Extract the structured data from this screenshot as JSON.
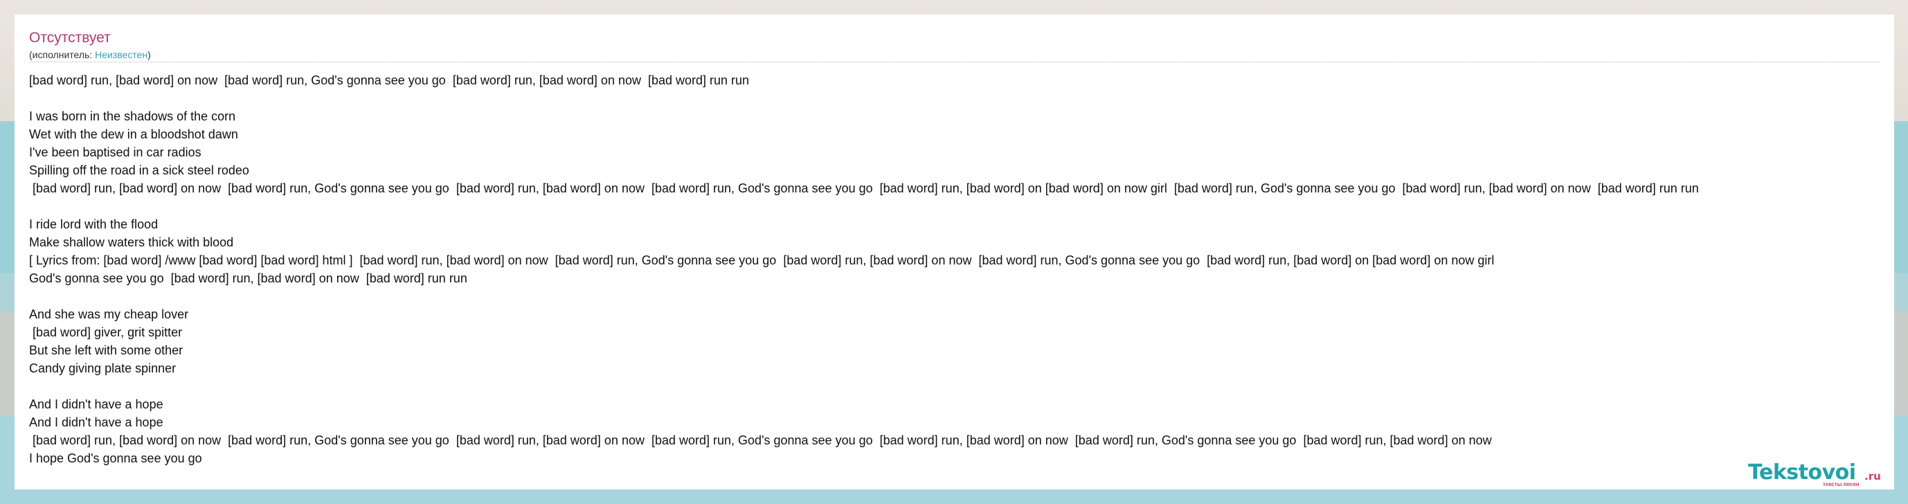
{
  "song": {
    "title": "Отсутствует",
    "artist_prefix": "(исполнитель: ",
    "artist_name": "Неизвестен",
    "artist_suffix": ")"
  },
  "lyrics": [
    "[bad word] run, [bad word] on now  [bad word] run, God's gonna see you go  [bad word] run, [bad word] on now  [bad word] run run",
    "",
    "I was born in the shadows of the corn",
    "Wet with the dew in a bloodshot dawn",
    "I've been baptised in car radios",
    "Spilling off the road in a sick steel rodeo",
    " [bad word] run, [bad word] on now  [bad word] run, God's gonna see you go  [bad word] run, [bad word] on now  [bad word] run, God's gonna see you go  [bad word] run, [bad word] on [bad word] on now girl  [bad word] run, God's gonna see you go  [bad word] run, [bad word] on now  [bad word] run run",
    "",
    "I ride lord with the flood",
    "Make shallow waters thick with blood",
    "[ Lyrics from: [bad word] /www [bad word] [bad word] html ]  [bad word] run, [bad word] on now  [bad word] run, God's gonna see you go  [bad word] run, [bad word] on now  [bad word] run, God's gonna see you go  [bad word] run, [bad word] on [bad word] on now girl",
    "God's gonna see you go  [bad word] run, [bad word] on now  [bad word] run run",
    "",
    "And she was my cheap lover",
    " [bad word] giver, grit spitter",
    "But she left with some other",
    "Candy giving plate spinner",
    "",
    "And I didn't have a hope",
    "And I didn't have a hope",
    " [bad word] run, [bad word] on now  [bad word] run, God's gonna see you go  [bad word] run, [bad word] on now  [bad word] run, God's gonna see you go  [bad word] run, [bad word] on now  [bad word] run, God's gonna see you go  [bad word] run, [bad word] on now",
    "I hope God's gonna see you go"
  ],
  "logo": {
    "name": "Tekstovoi",
    "domain": ".ru",
    "tagline": "тексты песен"
  },
  "colors": {
    "title": "#b03b6a",
    "link": "#3aa0b8",
    "logo_main": "#1fa2a8",
    "logo_accent": "#d93a6d"
  }
}
